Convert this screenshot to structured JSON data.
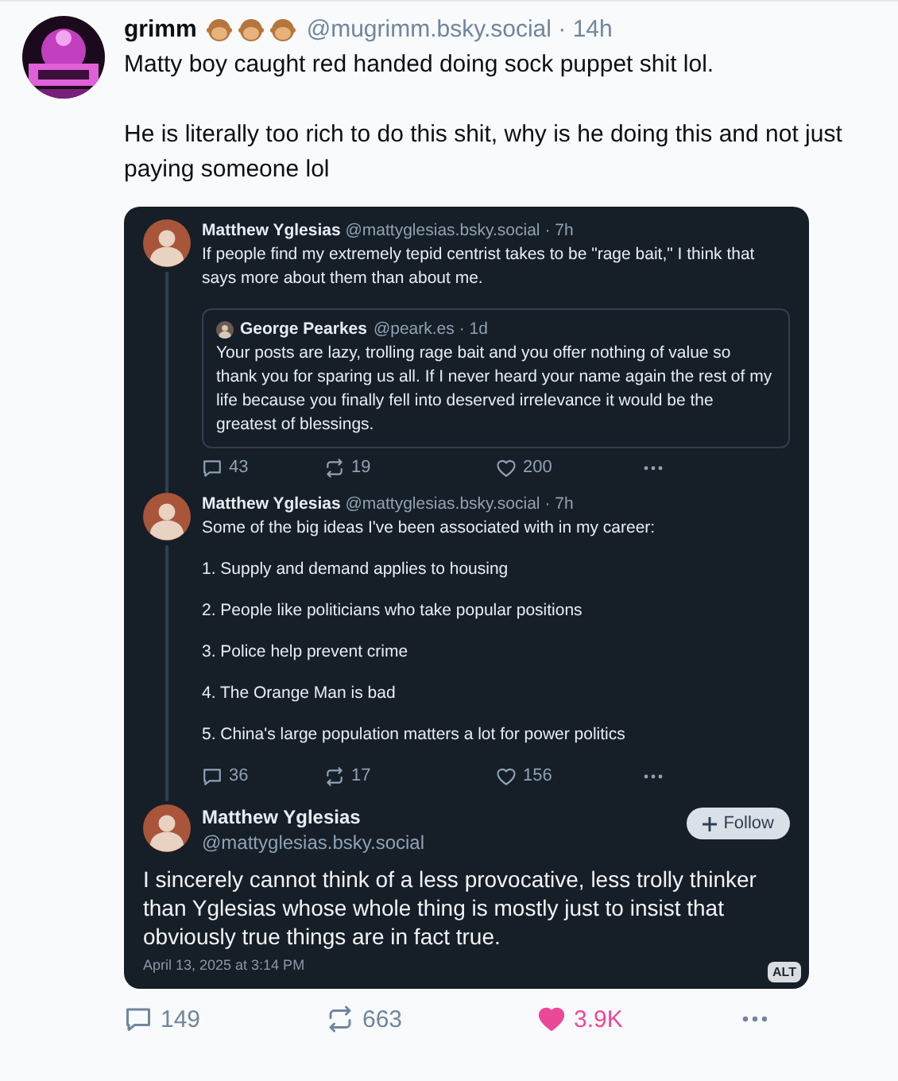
{
  "post": {
    "author": "grimm",
    "handle": "@mugrimm.bsky.social",
    "time": "· 14h",
    "paragraphs": [
      "Matty boy caught red handed doing sock puppet shit lol.",
      "He is literally too rich to do this shit, why is he doing this and not just paying someone lol"
    ],
    "image": {
      "thread": [
        {
          "author": "Matthew Yglesias",
          "handle": "@mattyglesias.bsky.social",
          "time": "· 7h",
          "paragraphs": [
            "If people find my extremely tepid centrist takes to be \"rage bait,\" I think that says more about them than about me."
          ],
          "quote": {
            "author": "George Pearkes",
            "handle": "@peark.es",
            "time": "· 1d",
            "text": "Your posts are lazy, trolling rage bait and you offer nothing of value so thank you for sparing us all. If I never heard your name again the rest of my life because you finally fell into deserved irrelevance it would be the greatest of blessings."
          },
          "stats": {
            "replies": "43",
            "reposts": "19",
            "likes": "200"
          }
        },
        {
          "author": "Matthew Yglesias",
          "handle": "@mattyglesias.bsky.social",
          "time": "· 7h",
          "paragraphs": [
            "Some of the big ideas I've been associated with in my career:",
            "1. Supply and demand applies to housing",
            "2. People like politicians who take popular positions",
            "3. Police help prevent crime",
            "4. The Orange Man is bad",
            "5. China's large population matters a lot for power politics"
          ],
          "stats": {
            "replies": "36",
            "reposts": "17",
            "likes": "156"
          }
        }
      ],
      "final": {
        "author": "Matthew Yglesias",
        "handle": "@mattyglesias.bsky.social",
        "follow_label": "Follow",
        "text": "I sincerely cannot think of a less provocative, less trolly thinker than Yglesias whose whole thing is mostly just to insist that obviously true things are in fact true.",
        "date": "April 13, 2025 at 3:14 PM"
      },
      "alt_badge": "ALT"
    },
    "stats": {
      "replies": "149",
      "reposts": "663",
      "likes": "3.9K",
      "liked": true
    }
  }
}
